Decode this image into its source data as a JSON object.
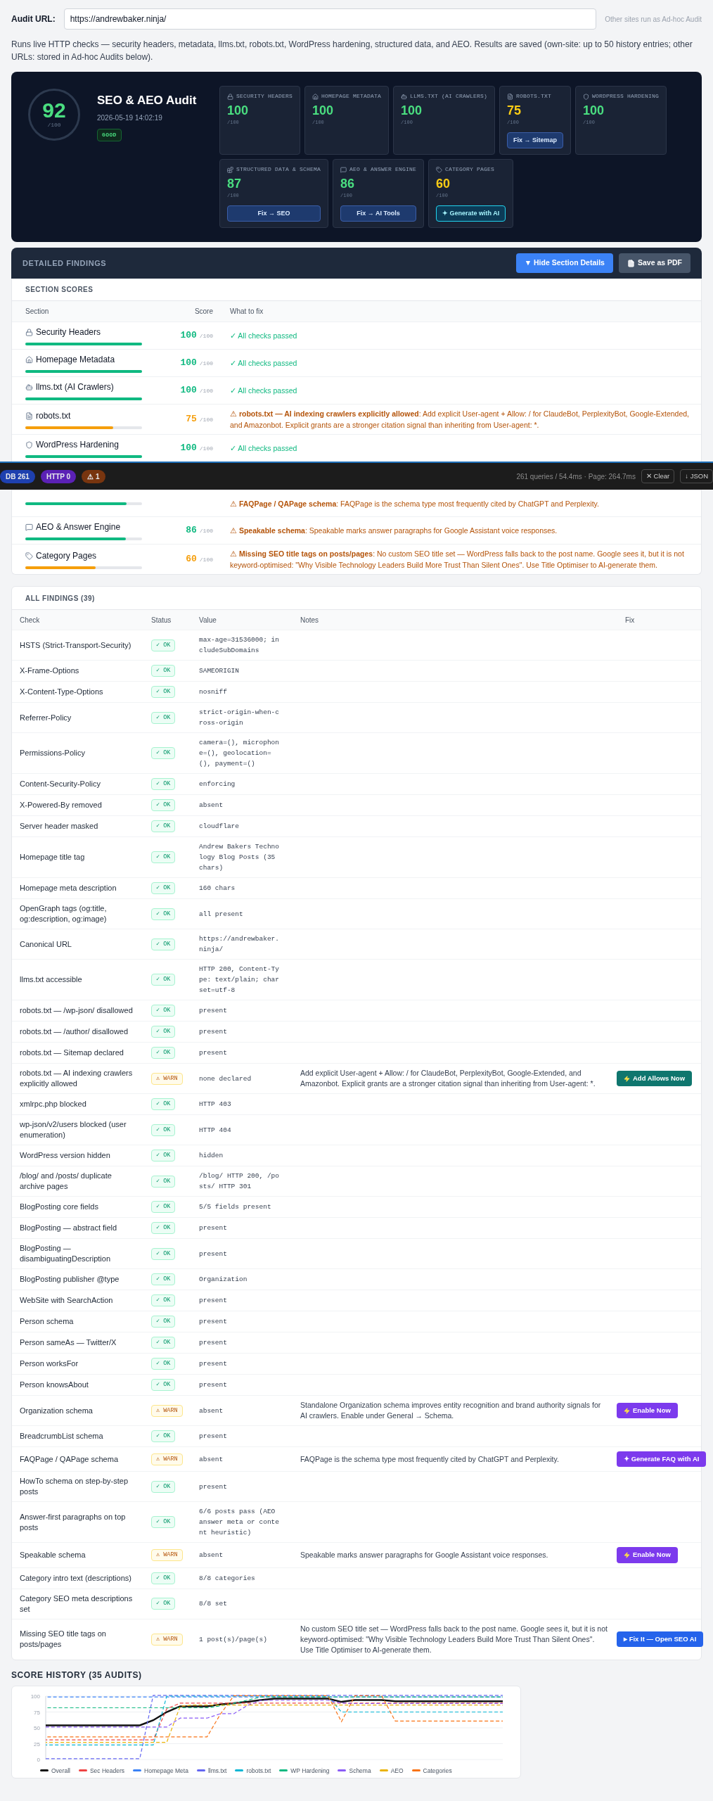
{
  "audit_url": {
    "label": "Audit URL:",
    "value": "https://andrewbaker.ninja/",
    "hint": "Other sites run as Ad-hoc Audit"
  },
  "description": "Runs live HTTP checks — security headers, metadata, llms.txt, robots.txt, WordPress hardening, structured data, and AEO. Results are saved (own-site: up to 50 history entries; other URLs: stored in Ad-hoc Audits below).",
  "summary": {
    "score": "92",
    "score_max": "/100",
    "title": "SEO & AEO Audit",
    "timestamp": "2026-05-19 14:02:19",
    "grade": "GOOD",
    "tile_rows": [
      [
        {
          "label": "SECURITY HEADERS",
          "score": "100",
          "max": "/100",
          "kind": "good"
        },
        {
          "label": "HOMEPAGE METADATA",
          "score": "100",
          "max": "/100",
          "kind": "good"
        },
        {
          "label": "LLMS.TXT (AI CRAWLERS)",
          "score": "100",
          "max": "/100",
          "kind": "good"
        },
        {
          "label": "ROBOTS.TXT",
          "score": "75",
          "max": "/100",
          "kind": "warn",
          "action": {
            "kind": "fix",
            "label": "Fix → Sitemap"
          }
        },
        {
          "label": "WORDPRESS HARDENING",
          "score": "100",
          "max": "/100",
          "kind": "good"
        }
      ],
      [
        {
          "label": "STRUCTURED DATA & SCHEMA",
          "score": "87",
          "max": "/100",
          "kind": "good",
          "action": {
            "kind": "fix",
            "label": "Fix → SEO"
          }
        },
        {
          "label": "AEO & ANSWER ENGINE",
          "score": "86",
          "max": "/100",
          "kind": "good",
          "action": {
            "kind": "fix",
            "label": "Fix → AI Tools"
          }
        },
        {
          "label": "CATEGORY PAGES",
          "score": "60",
          "max": "/100",
          "kind": "warn",
          "action": {
            "kind": "ai",
            "label": "✦ Generate with AI"
          }
        }
      ]
    ]
  },
  "detailed_findings": {
    "title": "DETAILED FINDINGS",
    "buttons": [
      {
        "kind": "toggle",
        "label": "▼ Hide Section Details"
      },
      {
        "kind": "pdf",
        "label": "Save as PDF"
      }
    ]
  },
  "section_scores": {
    "title": "SECTION SCORES",
    "columns": [
      "Section",
      "Score",
      "What to fix"
    ],
    "rows": [
      {
        "name": "Security Headers",
        "score": "100",
        "max": "/100",
        "kind": "good",
        "level": 1,
        "fix": {
          "kind": "pass",
          "text": "✓ All checks passed"
        }
      },
      {
        "name": "Homepage Metadata",
        "score": "100",
        "max": "/100",
        "kind": "good",
        "level": 1,
        "fix": {
          "kind": "pass",
          "text": "✓ All checks passed"
        }
      },
      {
        "name": "llms.txt (AI Crawlers)",
        "score": "100",
        "max": "/100",
        "kind": "good",
        "level": 1,
        "fix": {
          "kind": "pass",
          "text": "✓ All checks passed"
        }
      },
      {
        "name": "robots.txt",
        "score": "75",
        "max": "/100",
        "kind": "warn",
        "level": 0.75,
        "fix": {
          "kind": "warn",
          "text": "⚠ **robots.txt — AI indexing crawlers explicitly allowed**: Add explicit User-agent + Allow: / for ClaudeBot, PerplexityBot, Google-Extended, and Amazonbot. Explicit grants are a stronger citation signal than inheriting from User-agent: *."
        }
      },
      {
        "name": "WordPress Hardening",
        "score": "100",
        "max": "/100",
        "kind": "good",
        "level": 1,
        "fix": {
          "kind": "pass",
          "text": "✓ All checks passed"
        }
      },
      {
        "kind": "good",
        "level": 0.87,
        "fix": {
          "kind": "warn",
          "text": "⚠ **FAQPage / QAPage schema**: FAQPage is the schema type most frequently cited by ChatGPT and Perplexity."
        }
      },
      {
        "name": "AEO & Answer Engine",
        "score": "86",
        "max": "/100",
        "kind": "good",
        "level": 0.86,
        "fix": {
          "kind": "warn",
          "text": "⚠ **Speakable schema**: Speakable marks answer paragraphs for Google Assistant voice responses."
        }
      },
      {
        "name": "Category Pages",
        "score": "60",
        "max": "/100",
        "kind": "warn",
        "level": 0.6,
        "fix": {
          "kind": "warn",
          "text": "⚠ **Missing SEO title tags on posts/pages**: No custom SEO title set — WordPress falls back to the post name. Google sees it, but it is not keyword-optimised: \"Why Visible Technology Leaders Build More Trust Than Silent Ones\". Use Title Optimiser to AI-generate them."
        }
      }
    ]
  },
  "dev_bar": {
    "pills": [
      {
        "text": "DB 261",
        "color": "#1e40af"
      },
      {
        "text": "HTTP 0",
        "color": "#5b21b6"
      },
      {
        "text": "⚠ 1",
        "color": "#78350f"
      }
    ],
    "stats": "261 queries / 54.4ms · Page: 264.7ms",
    "buttons": [
      "✕ Clear",
      "↓ JSON"
    ]
  },
  "all_findings": {
    "title": "ALL FINDINGS (39)",
    "columns": [
      "Check",
      "Status",
      "Value",
      "Notes",
      "Fix"
    ],
    "rows": [
      {
        "check": "HSTS (Strict-Transport-Security)",
        "status": {
          "kind": "ok",
          "text": "✓ OK"
        },
        "value": "max-age=31536000; includeSubDomains"
      },
      {
        "check": "X-Frame-Options",
        "status": {
          "kind": "ok",
          "text": "✓ OK"
        },
        "value": "SAMEORIGIN"
      },
      {
        "check": "X-Content-Type-Options",
        "status": {
          "kind": "ok",
          "text": "✓ OK"
        },
        "value": "nosniff"
      },
      {
        "check": "Referrer-Policy",
        "status": {
          "kind": "ok",
          "text": "✓ OK"
        },
        "value": "strict-origin-when-cross-origin"
      },
      {
        "check": "Permissions-Policy",
        "status": {
          "kind": "ok",
          "text": "✓ OK"
        },
        "value": "camera=(), microphone=(), geolocation=(), payment=()"
      },
      {
        "check": "Content-Security-Policy",
        "status": {
          "kind": "ok",
          "text": "✓ OK"
        },
        "value": "enforcing"
      },
      {
        "check": "X-Powered-By removed",
        "status": {
          "kind": "ok",
          "text": "✓ OK"
        },
        "value": "absent"
      },
      {
        "check": "Server header masked",
        "status": {
          "kind": "ok",
          "text": "✓ OK"
        },
        "value": "cloudflare"
      },
      {
        "check": "Homepage title tag",
        "status": {
          "kind": "ok",
          "text": "✓ OK"
        },
        "value": "Andrew Bakers Technology Blog Posts (35 chars)"
      },
      {
        "check": "Homepage meta description",
        "status": {
          "kind": "ok",
          "text": "✓ OK"
        },
        "value": "160 chars"
      },
      {
        "check": "OpenGraph tags (og:title, og:description, og:image)",
        "status": {
          "kind": "ok",
          "text": "✓ OK"
        },
        "value": "all present"
      },
      {
        "check": "Canonical URL",
        "status": {
          "kind": "ok",
          "text": "✓ OK"
        },
        "value": "https://andrewbaker.ninja/"
      },
      {
        "check": "llms.txt accessible",
        "status": {
          "kind": "ok",
          "text": "✓ OK"
        },
        "value": "HTTP 200, Content-Type: text/plain; charset=utf-8"
      },
      {
        "check": "robots.txt — /wp-json/ disallowed",
        "status": {
          "kind": "ok",
          "text": "✓ OK"
        },
        "value": "present"
      },
      {
        "check": "robots.txt — /author/ disallowed",
        "status": {
          "kind": "ok",
          "text": "✓ OK"
        },
        "value": "present"
      },
      {
        "check": "robots.txt — Sitemap declared",
        "status": {
          "kind": "ok",
          "text": "✓ OK"
        },
        "value": "present"
      },
      {
        "check": "robots.txt — AI indexing crawlers explicitly allowed",
        "status": {
          "kind": "warn",
          "text": "⚠ WARN"
        },
        "value": "none declared",
        "notes": "Add explicit User-agent + Allow: / for ClaudeBot, PerplexityBot, Google-Extended, and Amazonbot. Explicit grants are a stronger citation signal than inheriting from User-agent: *.",
        "fix": {
          "kind": "add",
          "label": "Add Allows Now"
        }
      },
      {
        "check": "xmlrpc.php blocked",
        "status": {
          "kind": "ok",
          "text": "✓ OK"
        },
        "value": "HTTP 403"
      },
      {
        "check": "wp-json/v2/users blocked (user enumeration)",
        "status": {
          "kind": "ok",
          "text": "✓ OK"
        },
        "value": "HTTP 404"
      },
      {
        "check": "WordPress version hidden",
        "status": {
          "kind": "ok",
          "text": "✓ OK"
        },
        "value": "hidden"
      },
      {
        "check": "/blog/ and /posts/ duplicate archive pages",
        "status": {
          "kind": "ok",
          "text": "✓ OK"
        },
        "value": "/blog/ HTTP 200, /posts/ HTTP 301"
      },
      {
        "check": "BlogPosting core fields",
        "status": {
          "kind": "ok",
          "text": "✓ OK"
        },
        "value": "5/5 fields present"
      },
      {
        "check": "BlogPosting — abstract field",
        "status": {
          "kind": "ok",
          "text": "✓ OK"
        },
        "value": "present"
      },
      {
        "check": "BlogPosting — disambiguatingDescription",
        "status": {
          "kind": "ok",
          "text": "✓ OK"
        },
        "value": "present"
      },
      {
        "check": "BlogPosting publisher @type",
        "status": {
          "kind": "ok",
          "text": "✓ OK"
        },
        "value": "Organization"
      },
      {
        "check": "WebSite with SearchAction",
        "status": {
          "kind": "ok",
          "text": "✓ OK"
        },
        "value": "present"
      },
      {
        "check": "Person schema",
        "status": {
          "kind": "ok",
          "text": "✓ OK"
        },
        "value": "present"
      },
      {
        "check": "Person sameAs — Twitter/X",
        "status": {
          "kind": "ok",
          "text": "✓ OK"
        },
        "value": "present"
      },
      {
        "check": "Person worksFor",
        "status": {
          "kind": "ok",
          "text": "✓ OK"
        },
        "value": "present"
      },
      {
        "check": "Person knowsAbout",
        "status": {
          "kind": "ok",
          "text": "✓ OK"
        },
        "value": "present"
      },
      {
        "check": "Organization schema",
        "status": {
          "kind": "warn",
          "text": "⚠ WARN"
        },
        "value": "absent",
        "notes": "Standalone Organization schema improves entity recognition and brand authority signals for AI crawlers. Enable under General → Schema.",
        "fix": {
          "kind": "enable",
          "label": "Enable Now"
        }
      },
      {
        "check": "BreadcrumbList schema",
        "status": {
          "kind": "ok",
          "text": "✓ OK"
        },
        "value": "present"
      },
      {
        "check": "FAQPage / QAPage schema",
        "status": {
          "kind": "warn",
          "text": "⚠ WARN"
        },
        "value": "absent",
        "notes": "FAQPage is the schema type most frequently cited by ChatGPT and Perplexity.",
        "fix": {
          "kind": "generate",
          "label": "✦ Generate FAQ with AI"
        }
      },
      {
        "check": "HowTo schema on step-by-step posts",
        "status": {
          "kind": "ok",
          "text": "✓ OK"
        },
        "value": "present"
      },
      {
        "check": "Answer-first paragraphs on top posts",
        "status": {
          "kind": "ok",
          "text": "✓ OK"
        },
        "value": "6/6 posts pass (AEO answer meta or content heuristic)"
      },
      {
        "check": "Speakable schema",
        "status": {
          "kind": "warn",
          "text": "⚠ WARN"
        },
        "value": "absent",
        "notes": "Speakable marks answer paragraphs for Google Assistant voice responses.",
        "fix": {
          "kind": "enable",
          "label": "Enable Now"
        }
      },
      {
        "check": "Category intro text (descriptions)",
        "status": {
          "kind": "ok",
          "text": "✓ OK"
        },
        "value": "8/8 categories"
      },
      {
        "check": "Category SEO meta descriptions set",
        "status": {
          "kind": "ok",
          "text": "✓ OK"
        },
        "value": "8/8 set"
      },
      {
        "check": "Missing SEO title tags on posts/pages",
        "status": {
          "kind": "warn",
          "text": "⚠ WARN"
        },
        "value": "1 post(s)/page(s)",
        "notes": "No custom SEO title set — WordPress falls back to the post name. Google sees it, but it is not keyword-optimised: \"Why Visible Technology Leaders Build More Trust Than Silent Ones\". Use Title Optimiser to AI-generate them.",
        "fix": {
          "kind": "open",
          "label": "▸ Fix It — Open SEO AI"
        }
      }
    ]
  },
  "score_history": {
    "chart_data": {
      "type": "line",
      "title": "SCORE HISTORY (35 AUDITS)",
      "ylim": [
        0,
        100
      ],
      "yticks": [
        0,
        25,
        50,
        75,
        100
      ],
      "grid": true,
      "legend": true,
      "series": [
        {
          "name": "Overall",
          "color": "#111111",
          "line_style": "solid",
          "values": [
            54,
            54,
            54,
            54,
            54,
            54,
            54,
            54,
            62,
            75,
            84,
            84,
            84,
            87,
            89,
            91,
            94,
            96,
            96,
            96,
            96,
            96,
            91,
            94,
            94,
            94,
            92,
            92,
            92,
            92,
            92,
            92,
            92,
            92,
            92
          ]
        },
        {
          "name": "Sec Headers",
          "color": "#ef4444",
          "line_style": "dashed",
          "values": [
            31,
            31,
            31,
            31,
            31,
            31,
            31,
            31,
            31,
            80,
            89,
            89,
            89,
            89,
            89,
            89,
            89,
            89,
            89,
            89,
            89,
            89,
            89,
            89,
            89,
            89,
            89,
            89,
            89,
            89,
            89,
            89,
            89,
            89,
            89
          ]
        },
        {
          "name": "Homepage Meta",
          "color": "#3b82f6",
          "line_style": "dashed",
          "values": [
            100,
            100,
            100,
            100,
            100,
            100,
            100,
            100,
            100,
            100,
            100,
            100,
            100,
            100,
            100,
            100,
            100,
            100,
            100,
            100,
            100,
            100,
            100,
            100,
            100,
            100,
            100,
            100,
            100,
            100,
            100,
            100,
            100,
            100,
            100
          ]
        },
        {
          "name": "llms.txt",
          "color": "#6366f1",
          "line_style": "dashed",
          "values": [
            0,
            0,
            0,
            0,
            0,
            0,
            0,
            0,
            100,
            100,
            100,
            100,
            100,
            100,
            100,
            100,
            100,
            100,
            100,
            100,
            100,
            100,
            100,
            100,
            100,
            100,
            100,
            100,
            100,
            100,
            100,
            100,
            100,
            100,
            100
          ]
        },
        {
          "name": "robots.txt",
          "color": "#06b6d4",
          "line_style": "dashed",
          "values": [
            23,
            23,
            23,
            23,
            23,
            23,
            23,
            23,
            23,
            100,
            100,
            100,
            100,
            100,
            100,
            100,
            100,
            100,
            100,
            100,
            100,
            100,
            75,
            75,
            75,
            75,
            75,
            75,
            75,
            75,
            75,
            75,
            75,
            75,
            75
          ]
        },
        {
          "name": "WP Hardening",
          "color": "#10b981",
          "line_style": "dashed",
          "values": [
            83,
            83,
            83,
            83,
            83,
            83,
            83,
            83,
            83,
            83,
            83,
            83,
            83,
            86,
            90,
            95,
            100,
            100,
            100,
            100,
            100,
            100,
            100,
            100,
            100,
            100,
            100,
            100,
            100,
            100,
            100,
            100,
            100,
            100,
            100
          ]
        },
        {
          "name": "Schema",
          "color": "#8b5cf6",
          "line_style": "dashed",
          "values": [
            50,
            50,
            50,
            50,
            50,
            50,
            50,
            50,
            50,
            50,
            64,
            64,
            64,
            71,
            71,
            84,
            92,
            92,
            92,
            92,
            92,
            92,
            88,
            87,
            87,
            87,
            87,
            87,
            87,
            87,
            87,
            87,
            87,
            87,
            87
          ]
        },
        {
          "name": "AEO",
          "color": "#eab308",
          "line_style": "dashed",
          "values": [
            27,
            27,
            27,
            27,
            27,
            27,
            27,
            27,
            27,
            27,
            84,
            86,
            86,
            86,
            86,
            86,
            86,
            86,
            86,
            86,
            86,
            86,
            86,
            86,
            86,
            86,
            86,
            86,
            86,
            86,
            86,
            86,
            86,
            86,
            86
          ]
        },
        {
          "name": "Categories",
          "color": "#f97316",
          "line_style": "dashed",
          "values": [
            35,
            35,
            35,
            35,
            35,
            35,
            35,
            35,
            35,
            35,
            35,
            35,
            35,
            71,
            100,
            100,
            100,
            100,
            100,
            100,
            100,
            100,
            59,
            100,
            100,
            100,
            60,
            60,
            60,
            60,
            60,
            60,
            60,
            60,
            60
          ]
        }
      ]
    }
  }
}
